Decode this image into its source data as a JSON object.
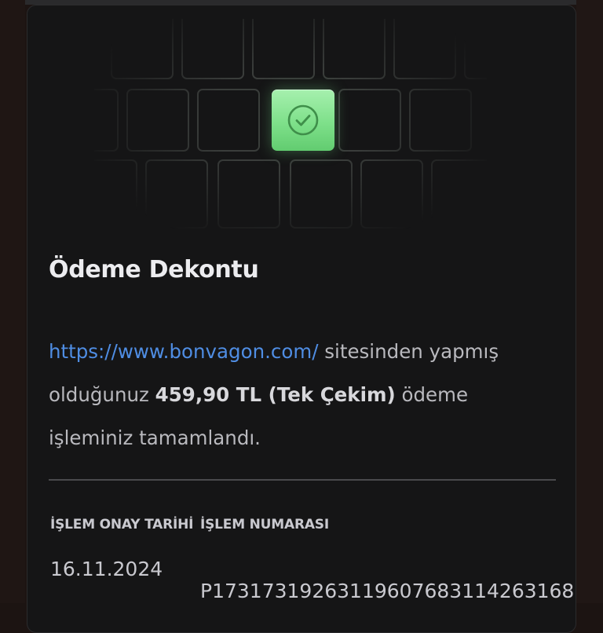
{
  "receipt": {
    "title": "Ödeme Dekontu",
    "site_link": "https://www.bonvagon.com/",
    "desc_part1": "sitesinden yapmış olduğunuz",
    "amount_text": "459,90 TL (Tek Çekim)",
    "desc_part2": "ödeme işleminiz tamamlandı.",
    "approval_date_label": "İŞLEM ONAY TARİHİ",
    "approval_date_value": "16.11.2024",
    "transaction_number_label": "İŞLEM NUMARASI",
    "transaction_number_value": "P17317319263119607683114263168"
  },
  "icons": {
    "status": "check-circle-icon"
  },
  "colors": {
    "link": "#4f8de3",
    "success": "#7ee08a",
    "background": "#151516"
  }
}
